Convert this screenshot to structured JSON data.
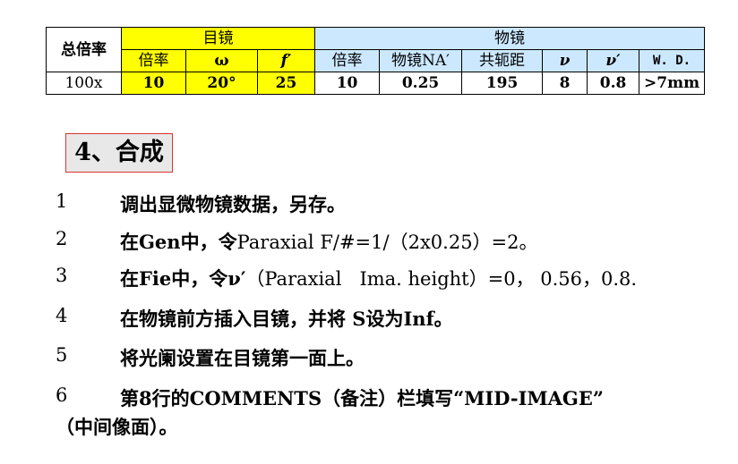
{
  "table": {
    "header_total": "总倍率",
    "header_eyepiece": "目镜",
    "header_objective": "物镜",
    "eyepiece_cols": [
      "倍率",
      "ω",
      "f′"
    ],
    "objective_cols": [
      "倍率",
      "物镜NA′",
      "共轭距",
      "ν",
      "ν′",
      "W. D."
    ],
    "row": {
      "total": "100x",
      "eyepiece": [
        "10",
        "20°",
        "25"
      ],
      "objective": [
        "10",
        "0.25",
        "195",
        "8",
        "0.8",
        ">7mm"
      ]
    },
    "colors": {
      "eyepiece": "#ffff00",
      "objective": "#cce8ff"
    }
  },
  "section_title": "4、合成",
  "steps": [
    {
      "num": "1",
      "text": "调出显微物镜数据，另存。"
    },
    {
      "num": "2",
      "text_cn1": "在Gen中，令",
      "text_latin": "Paraxial F/#=1/（2x0.25）=2。"
    },
    {
      "num": "3",
      "text_cn1": "在Fie中，令ν′",
      "text_latin": "（Paraxial   Ima. height）=0， 0.56，0.8."
    },
    {
      "num": "4",
      "text": "在物镜前方插入目镜，并将 S设为Inf。"
    },
    {
      "num": "5",
      "text": "将光阑设置在目镜第一面上。"
    },
    {
      "num": "6",
      "text": "第8行的COMMENTS（备注）栏填写“MID-IMAGE”"
    },
    {
      "num": "",
      "text": "（中间像面）。"
    }
  ]
}
